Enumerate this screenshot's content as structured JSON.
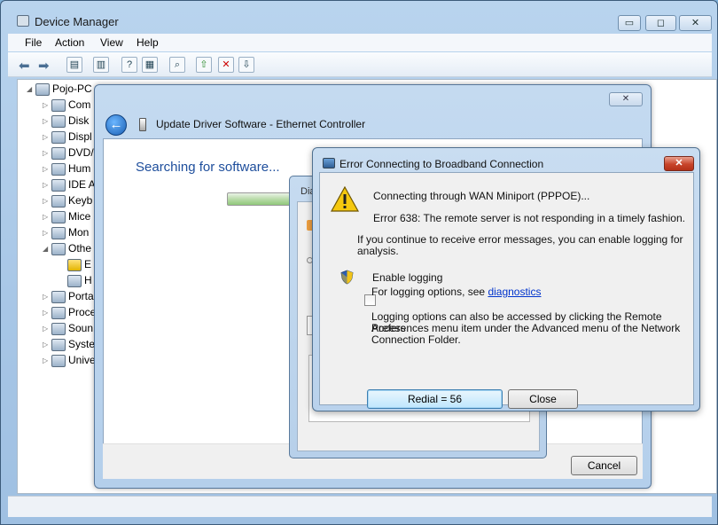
{
  "device_manager": {
    "title": "Device Manager",
    "caption_min": "▭",
    "caption_max": "◻",
    "caption_close": "✕",
    "menu": [
      "File",
      "Action",
      "View",
      "Help"
    ],
    "tree": {
      "root": "Pojo-PC",
      "items": [
        "Com",
        "Disk",
        "Displ",
        "DVD/",
        "Hum",
        "IDE A",
        "Keyb",
        "Mice",
        "Mon",
        "Othe",
        "E",
        "H",
        "Porta",
        "Proce",
        "Soun",
        "Syste",
        "Unive"
      ]
    }
  },
  "update_driver": {
    "title": "Update Driver Software - Ethernet Controller",
    "heading": "Searching for software...",
    "cancel_label": "Cancel",
    "close_glyph": "✕",
    "back_glyph": "←"
  },
  "partial_dialog": {
    "title_fragment": "Dia"
  },
  "error_dialog": {
    "title": "Error Connecting to Broadband Connection",
    "close_glyph": "✕",
    "line1": "Connecting through WAN Miniport (PPPOE)...",
    "line2": "Error 638: The remote server is not responding in a timely fashion.",
    "info_line1": "If you continue to receive error messages, you can enable logging for",
    "info_line2": "analysis.",
    "enable_logging": "Enable logging",
    "logging_options_prefix": "For logging options, see",
    "diagnostics_link": "diagnostics",
    "access_line1": "Logging options can also be accessed by clicking the Remote Access",
    "access_line2": "Preferences menu item under the Advanced menu of the Network",
    "access_line3": "Connection Folder.",
    "redial_label": "Redial = 56",
    "close_label": "Close"
  }
}
